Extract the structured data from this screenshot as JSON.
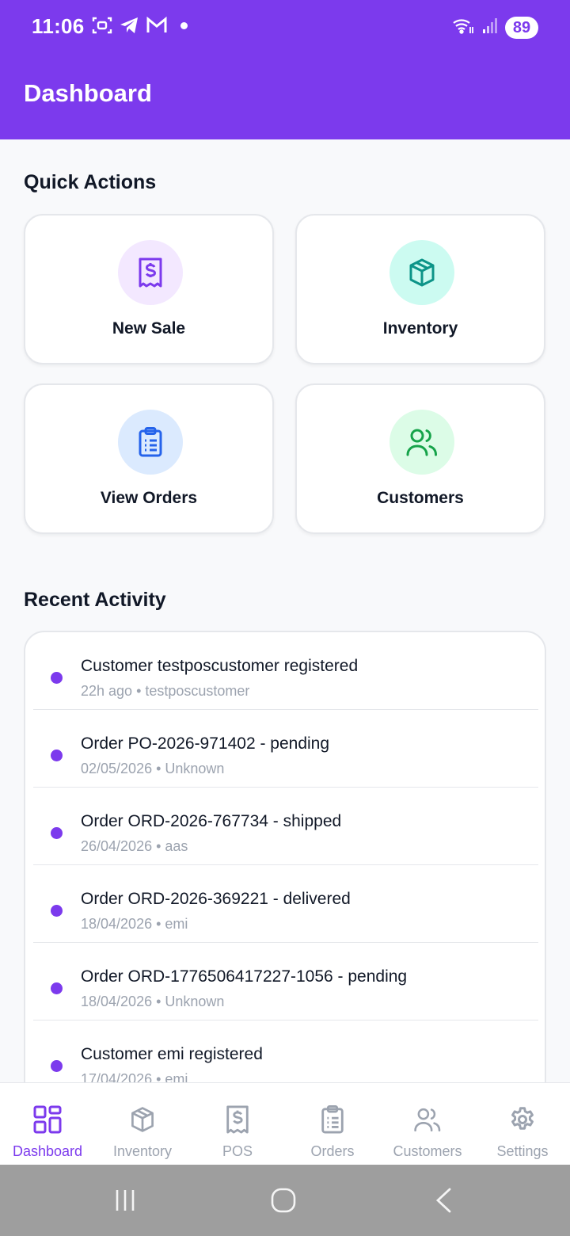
{
  "status_bar": {
    "time": "11:06",
    "battery": "89",
    "icons": [
      "screen-record-icon",
      "telegram-icon",
      "gmail-icon",
      "notification-dot-icon",
      "wifi-icon",
      "signal-icon",
      "battery-icon"
    ]
  },
  "header": {
    "title": "Dashboard"
  },
  "quick_actions": {
    "title": "Quick Actions",
    "items": [
      {
        "label": "New Sale",
        "icon": "receipt-dollar-icon",
        "color": "#7c3aed",
        "bg": "#f3e8ff"
      },
      {
        "label": "Inventory",
        "icon": "box-icon",
        "color": "#0d9488",
        "bg": "#ccfbf1"
      },
      {
        "label": "View Orders",
        "icon": "clipboard-list-icon",
        "color": "#2563eb",
        "bg": "#dbeafe"
      },
      {
        "label": "Customers",
        "icon": "users-icon",
        "color": "#16a34a",
        "bg": "#dcfce7"
      }
    ]
  },
  "recent_activity": {
    "title": "Recent Activity",
    "items": [
      {
        "title": "Customer testposcustomer registered",
        "meta": "22h ago • testposcustomer"
      },
      {
        "title": "Order PO-2026-971402 - pending",
        "meta": "02/05/2026 • Unknown"
      },
      {
        "title": "Order ORD-2026-767734 - shipped",
        "meta": "26/04/2026 • aas"
      },
      {
        "title": "Order ORD-2026-369221 - delivered",
        "meta": "18/04/2026 • emi"
      },
      {
        "title": "Order ORD-1776506417227-1056 - pending",
        "meta": "18/04/2026 • Unknown"
      },
      {
        "title": "Customer emi registered",
        "meta": "17/04/2026 • emi"
      }
    ]
  },
  "bottom_nav": {
    "active": "Dashboard",
    "items": [
      {
        "label": "Dashboard",
        "icon": "grid-icon"
      },
      {
        "label": "Inventory",
        "icon": "box-icon"
      },
      {
        "label": "POS",
        "icon": "receipt-dollar-icon"
      },
      {
        "label": "Orders",
        "icon": "clipboard-list-icon"
      },
      {
        "label": "Customers",
        "icon": "users-icon"
      },
      {
        "label": "Settings",
        "icon": "gear-icon"
      }
    ]
  },
  "colors": {
    "primary": "#7c3aed",
    "nav_inactive": "#9ca3af",
    "system_nav_bg": "#9e9e9e"
  }
}
